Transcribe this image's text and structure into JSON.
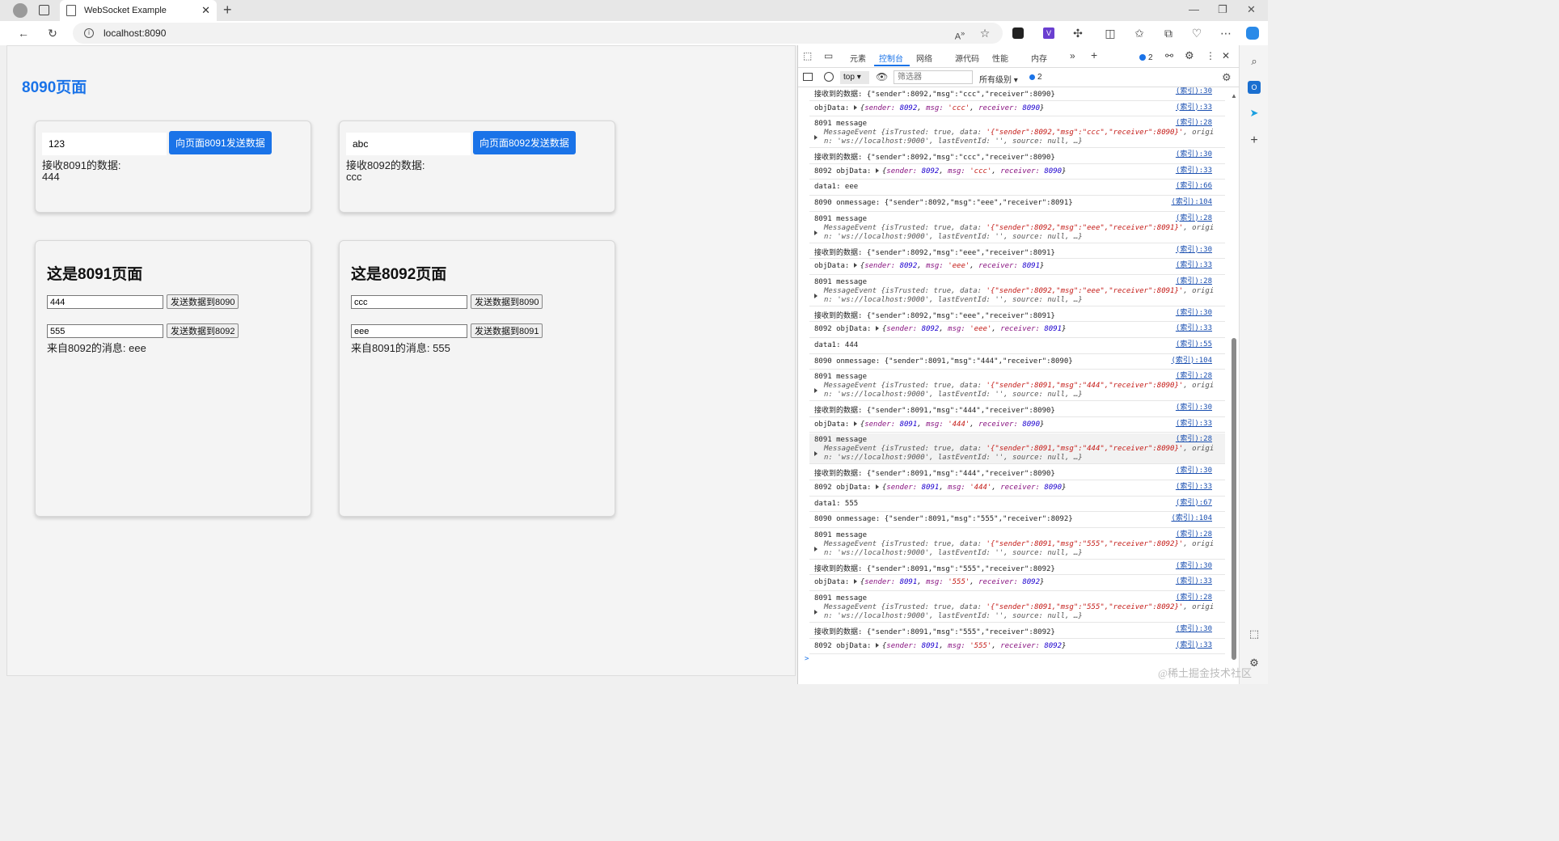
{
  "browser": {
    "tab_title": "WebSocket Example",
    "address": "localhost:8090",
    "toolbar_icons": [
      "read-aloud-icon",
      "favorite-icon",
      "extension-icon",
      "vue-devtools-icon",
      "puzzle-icon",
      "split-screen-icon",
      "favorites-icon",
      "collections-icon",
      "performance-icon",
      "more-icon",
      "copilot-icon"
    ]
  },
  "page": {
    "title": "8090页面",
    "card1": {
      "input_value": "123",
      "button": "向页面8091发送数据",
      "recv_label": "接收8091的数据:",
      "recv_value": "444"
    },
    "card2": {
      "input_value": "abc",
      "button": "向页面8092发送数据",
      "recv_label": "接收8092的数据:",
      "recv_value": "ccc"
    },
    "frame1": {
      "heading": "这是8091页面",
      "input1": "444",
      "button1": "发送数据到8090",
      "input2": "555",
      "button2": "发送数据到8092",
      "message": "来自8092的消息: eee"
    },
    "frame2": {
      "heading": "这是8092页面",
      "input1": "ccc",
      "button1": "发送数据到8090",
      "input2": "eee",
      "button2": "发送数据到8091",
      "message": "来自8091的消息: 555"
    }
  },
  "devtools": {
    "tabs": [
      "元素",
      "控制台",
      "网络",
      "源代码",
      "性能",
      "内存"
    ],
    "issues_count": "2",
    "context": "top",
    "filter_placeholder": "筛选器",
    "levels": "所有级别",
    "message_count": "2",
    "console": [
      {
        "type": "text",
        "text": "接收到的数据: {\"sender\":8092,\"msg\":\"ccc\",\"receiver\":8090}",
        "src": "(索引):30"
      },
      {
        "type": "obj",
        "label": "objData: ",
        "sender": "8092",
        "msg": "'ccc'",
        "receiver": "8090",
        "src": "(索引):33"
      },
      {
        "type": "event",
        "label": "8091 message",
        "data": "'{\"sender\":8092,\"msg\":\"ccc\",\"receiver\":8090}'",
        "src": "(索引):28"
      },
      {
        "type": "text",
        "text": "接收到的数据: {\"sender\":8092,\"msg\":\"ccc\",\"receiver\":8090}",
        "src": "(索引):30"
      },
      {
        "type": "obj",
        "label": "8092 objData: ",
        "sender": "8092",
        "msg": "'ccc'",
        "receiver": "8090",
        "src": "(索引):33"
      },
      {
        "type": "text",
        "text": "data1:  eee",
        "src": "(索引):66"
      },
      {
        "type": "text",
        "text": "8090 onmessage:  {\"sender\":8092,\"msg\":\"eee\",\"receiver\":8091}",
        "src": "(索引):104"
      },
      {
        "type": "event",
        "label": "8091 message",
        "data": "'{\"sender\":8092,\"msg\":\"eee\",\"receiver\":8091}'",
        "src": "(索引):28"
      },
      {
        "type": "text",
        "text": "接收到的数据: {\"sender\":8092,\"msg\":\"eee\",\"receiver\":8091}",
        "src": "(索引):30"
      },
      {
        "type": "obj",
        "label": "objData: ",
        "sender": "8092",
        "msg": "'eee'",
        "receiver": "8091",
        "src": "(索引):33"
      },
      {
        "type": "event",
        "label": "8091 message",
        "data": "'{\"sender\":8092,\"msg\":\"eee\",\"receiver\":8091}'",
        "src": "(索引):28"
      },
      {
        "type": "text",
        "text": "接收到的数据: {\"sender\":8092,\"msg\":\"eee\",\"receiver\":8091}",
        "src": "(索引):30"
      },
      {
        "type": "obj",
        "label": "8092 objData: ",
        "sender": "8092",
        "msg": "'eee'",
        "receiver": "8091",
        "src": "(索引):33"
      },
      {
        "type": "text",
        "text": "data1:  444",
        "src": "(索引):55"
      },
      {
        "type": "text",
        "text": "8090 onmessage:  {\"sender\":8091,\"msg\":\"444\",\"receiver\":8090}",
        "src": "(索引):104"
      },
      {
        "type": "event",
        "label": "8091 message",
        "data": "'{\"sender\":8091,\"msg\":\"444\",\"receiver\":8090}'",
        "src": "(索引):28"
      },
      {
        "type": "text",
        "text": "接收到的数据: {\"sender\":8091,\"msg\":\"444\",\"receiver\":8090}",
        "src": "(索引):30"
      },
      {
        "type": "obj",
        "label": "objData: ",
        "sender": "8091",
        "msg": "'444'",
        "receiver": "8090",
        "src": "(索引):33"
      },
      {
        "type": "event",
        "label": "8091 message",
        "data": "'{\"sender\":8091,\"msg\":\"444\",\"receiver\":8090}'",
        "src": "(索引):28",
        "highlight": true
      },
      {
        "type": "text",
        "text": "接收到的数据: {\"sender\":8091,\"msg\":\"444\",\"receiver\":8090}",
        "src": "(索引):30"
      },
      {
        "type": "obj",
        "label": "8092 objData: ",
        "sender": "8091",
        "msg": "'444'",
        "receiver": "8090",
        "src": "(索引):33"
      },
      {
        "type": "text",
        "text": "data1:  555",
        "src": "(索引):67"
      },
      {
        "type": "text",
        "text": "8090 onmessage:  {\"sender\":8091,\"msg\":\"555\",\"receiver\":8092}",
        "src": "(索引):104"
      },
      {
        "type": "event",
        "label": "8091 message",
        "data": "'{\"sender\":8091,\"msg\":\"555\",\"receiver\":8092}'",
        "src": "(索引):28"
      },
      {
        "type": "text",
        "text": "接收到的数据: {\"sender\":8091,\"msg\":\"555\",\"receiver\":8092}",
        "src": "(索引):30"
      },
      {
        "type": "obj",
        "label": "objData: ",
        "sender": "8091",
        "msg": "'555'",
        "receiver": "8092",
        "src": "(索引):33"
      },
      {
        "type": "event",
        "label": "8091 message",
        "data": "'{\"sender\":8091,\"msg\":\"555\",\"receiver\":8092}'",
        "src": "(索引):28"
      },
      {
        "type": "text",
        "text": "接收到的数据: {\"sender\":8091,\"msg\":\"555\",\"receiver\":8092}",
        "src": "(索引):30"
      },
      {
        "type": "obj",
        "label": "8092 objData: ",
        "sender": "8091",
        "msg": "'555'",
        "receiver": "8092",
        "src": "(索引):33"
      }
    ],
    "event_prefix": "MessageEvent {isTrusted: true, data: ",
    "event_suffix": ", origi",
    "event_line2": "n: 'ws://localhost:9000', lastEventId: '', source: null, …}",
    "prompt": ">"
  },
  "watermark": "@稀土掘金技术社区",
  "colors": {
    "accent": "#1a73e8",
    "link": "#1a4fb0"
  }
}
